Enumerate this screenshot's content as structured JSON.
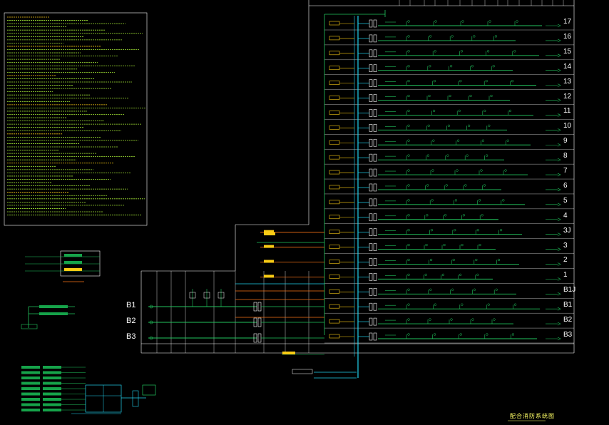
{
  "drawing": {
    "title": "配合消防系统图",
    "colors": {
      "background": "#000000",
      "frame": "#ffffff",
      "riser": "#22d3ee",
      "branch": "#22c55e",
      "device": "#facc15",
      "accent": "#f97316",
      "text": "#e5e7eb"
    }
  },
  "floors": [
    "17",
    "16",
    "15",
    "14",
    "13",
    "12",
    "11",
    "10",
    "9",
    "8",
    "7",
    "6",
    "5",
    "4",
    "3J",
    "3",
    "2",
    "1",
    "B1J",
    "B1",
    "B2",
    "B3"
  ],
  "basement_rows": [
    "B1",
    "B2",
    "B3"
  ]
}
